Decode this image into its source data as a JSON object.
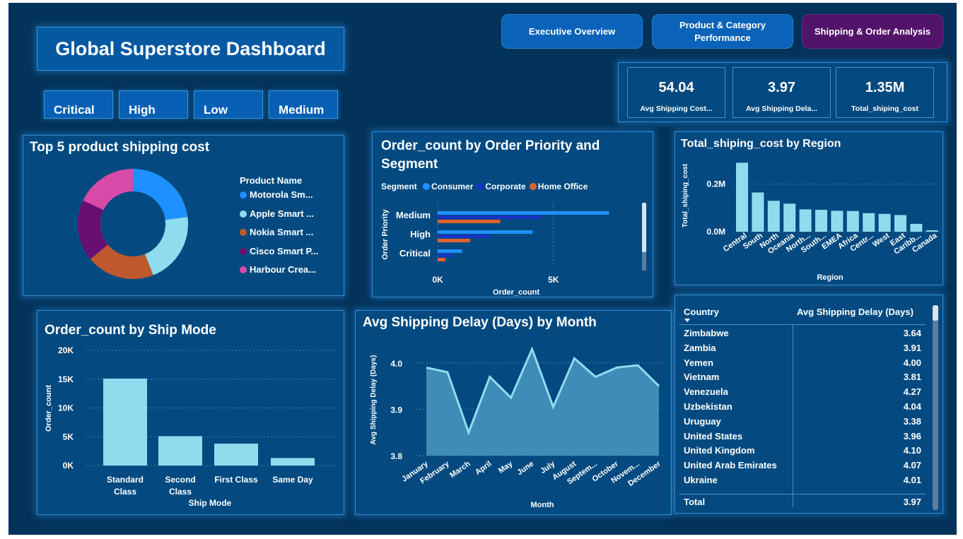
{
  "header": {
    "title": "Global Superstore Dashboard"
  },
  "nav": [
    {
      "label": "Executive Overview",
      "active": false
    },
    {
      "label": "Product & Category Performance",
      "active": false
    },
    {
      "label": "Shipping & Order Analysis",
      "active": true
    }
  ],
  "slicers": [
    "Critical",
    "High",
    "Low",
    "Medium"
  ],
  "kpis": [
    {
      "value": "54.04",
      "label": "Avg Shipping Cost..."
    },
    {
      "value": "3.97",
      "label": "Avg Shipping Dela..."
    },
    {
      "value": "1.35M",
      "label": "Total_shiping_cost"
    }
  ],
  "colors": {
    "background": "#03335a",
    "panel": "#044a80",
    "bar": "#8fdcef",
    "active_nav": "#52136a"
  },
  "donut": {
    "title": "Top 5 product shipping cost",
    "legend_title": "Product Name",
    "chart_data": {
      "type": "pie",
      "categories": [
        "Motorola Sm...",
        "Apple Smart ...",
        "Nokia Smart ...",
        "Cisco Smart P...",
        "Harbour Crea..."
      ],
      "values": [
        23,
        21,
        20,
        18,
        18
      ],
      "colors": [
        "#1e90ff",
        "#8fdcef",
        "#c0582d",
        "#6a0f72",
        "#d84aa8"
      ]
    }
  },
  "priority_chart": {
    "title_line1": "Order_count by Order Priority and",
    "title_line2": "Segment",
    "legend_title": "Segment",
    "chart_data": {
      "type": "bar",
      "orientation": "horizontal",
      "categories": [
        "Medium",
        "High",
        "Critical"
      ],
      "series": [
        {
          "name": "Consumer",
          "color": "#1e90ff",
          "values": [
            7400,
            4100,
            1050
          ]
        },
        {
          "name": "Corporate",
          "color": "#1833c2",
          "values": [
            4450,
            2300,
            580
          ]
        },
        {
          "name": "Home Office",
          "color": "#e0622c",
          "values": [
            2700,
            1400,
            340
          ]
        }
      ],
      "xlabel": "Order_count",
      "ylabel": "Order Priority",
      "xlim": [
        0,
        8000
      ],
      "xticks": [
        "0K",
        "5K"
      ],
      "xtick_values": [
        0,
        5000
      ]
    }
  },
  "region_chart": {
    "title": "Total_shiping_cost by Region",
    "chart_data": {
      "type": "bar",
      "categories": [
        "Central",
        "South",
        "North",
        "Oceania",
        "North...",
        "South...",
        "EMEA",
        "Africa",
        "Centr...",
        "West",
        "East",
        "Caribb...",
        "Canada"
      ],
      "values": [
        0.29,
        0.165,
        0.13,
        0.118,
        0.094,
        0.092,
        0.088,
        0.087,
        0.078,
        0.075,
        0.07,
        0.033,
        0.006
      ],
      "unit": "M",
      "xlabel": "Region",
      "ylabel": "Total_shiping_cost",
      "yticks": [
        "0.0M",
        "0.2M"
      ],
      "ytick_values": [
        0,
        0.2
      ],
      "ylim": [
        0,
        0.3
      ]
    }
  },
  "ship_mode_chart": {
    "title": "Order_count by Ship Mode",
    "chart_data": {
      "type": "bar",
      "categories": [
        "Standard Class",
        "Second Class",
        "First Class",
        "Same Day"
      ],
      "values": [
        15100,
        5100,
        3800,
        1300
      ],
      "xlabel": "Ship Mode",
      "ylabel": "Order_count",
      "yticks": [
        "0K",
        "5K",
        "10K",
        "15K",
        "20K"
      ],
      "ytick_values": [
        0,
        5000,
        10000,
        15000,
        20000
      ],
      "ylim": [
        0,
        20000
      ]
    }
  },
  "delay_chart": {
    "title": "Avg Shipping Delay (Days) by Month",
    "chart_data": {
      "type": "area",
      "categories": [
        "January",
        "February",
        "March",
        "April",
        "May",
        "June",
        "July",
        "August",
        "Septem...",
        "October",
        "Novem...",
        "December"
      ],
      "values": [
        3.99,
        3.98,
        3.85,
        3.97,
        3.925,
        4.03,
        3.905,
        4.01,
        3.97,
        3.99,
        3.995,
        3.95
      ],
      "xlabel": "Month",
      "ylabel": "Avg Shipping Delay (Days)",
      "yticks": [
        "3.8",
        "3.9",
        "4.0"
      ],
      "ytick_values": [
        3.8,
        3.9,
        4.0
      ],
      "ylim": [
        3.8,
        4.05
      ]
    }
  },
  "country_table": {
    "columns": [
      "Country",
      "Avg Shipping Delay (Days)"
    ],
    "rows": [
      [
        "Zimbabwe",
        "3.64"
      ],
      [
        "Zambia",
        "3.91"
      ],
      [
        "Yemen",
        "4.00"
      ],
      [
        "Vietnam",
        "3.81"
      ],
      [
        "Venezuela",
        "4.27"
      ],
      [
        "Uzbekistan",
        "4.04"
      ],
      [
        "Uruguay",
        "3.38"
      ],
      [
        "United States",
        "3.96"
      ],
      [
        "United Kingdom",
        "4.10"
      ],
      [
        "United Arab Emirates",
        "4.07"
      ],
      [
        "Ukraine",
        "4.01"
      ]
    ],
    "total_label": "Total",
    "total_value": "3.97"
  }
}
